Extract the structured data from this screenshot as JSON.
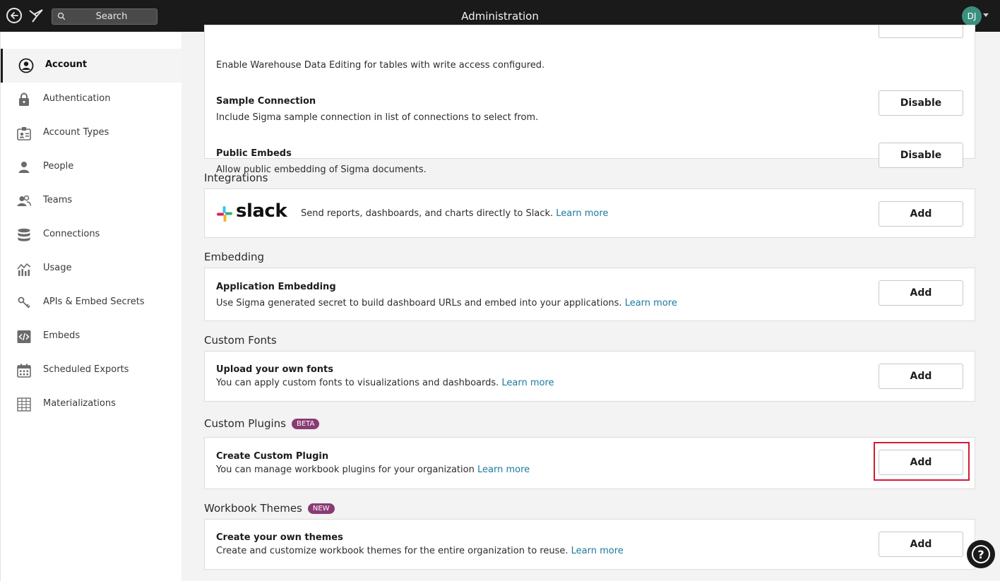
{
  "topbar": {
    "search_placeholder": "Search",
    "title": "Administration",
    "avatar_initials": "DJ"
  },
  "sidebar": {
    "items": [
      {
        "label": "Account",
        "icon": "account-circle-icon"
      },
      {
        "label": "Authentication",
        "icon": "lock-icon"
      },
      {
        "label": "Account Types",
        "icon": "id-badge-icon"
      },
      {
        "label": "People",
        "icon": "person-icon"
      },
      {
        "label": "Teams",
        "icon": "team-icon"
      },
      {
        "label": "Connections",
        "icon": "database-icon"
      },
      {
        "label": "Usage",
        "icon": "usage-icon"
      },
      {
        "label": "APIs & Embed Secrets",
        "icon": "key-icon"
      },
      {
        "label": "Embeds",
        "icon": "code-icon"
      },
      {
        "label": "Scheduled Exports",
        "icon": "calendar-icon"
      },
      {
        "label": "Materializations",
        "icon": "grid-icon"
      }
    ],
    "active": "Account"
  },
  "features": {
    "partial_desc": "Enable Warehouse Data Editing for tables with write access configured.",
    "sample_connection": {
      "title": "Sample Connection",
      "desc": "Include Sigma sample connection in list of connections to select from.",
      "button": "Disable"
    },
    "public_embeds": {
      "title": "Public Embeds",
      "desc": "Allow public embedding of Sigma documents.",
      "button": "Disable"
    }
  },
  "integrations": {
    "title": "Integrations",
    "slack_logo_text": "slack",
    "desc": "Send reports, dashboards, and charts directly to Slack.",
    "link": "Learn more",
    "button": "Add"
  },
  "embedding": {
    "title": "Embedding",
    "row_title": "Application Embedding",
    "desc": "Use Sigma generated secret to build dashboard URLs and embed into your applications.",
    "link": "Learn more",
    "button": "Add"
  },
  "custom_fonts": {
    "title": "Custom Fonts",
    "row_title": "Upload your own fonts",
    "desc": "You can apply custom fonts to visualizations and dashboards.",
    "link": "Learn more",
    "button": "Add"
  },
  "custom_plugins": {
    "title": "Custom Plugins",
    "badge": "BETA",
    "row_title": "Create Custom Plugin",
    "desc": "You can manage workbook plugins for your organization",
    "link": "Learn more",
    "button": "Add"
  },
  "workbook_themes": {
    "title": "Workbook Themes",
    "badge": "NEW",
    "row_title": "Create your own themes",
    "desc": "Create and customize workbook themes for the entire organization to reuse.",
    "link": "Learn more",
    "button": "Add"
  },
  "help_label": "?",
  "colors": {
    "accent_link": "#1a7aa0",
    "badge": "#8a3b75",
    "highlight": "#d21a35",
    "topbar": "#1a1a1a",
    "avatar": "#3b8f7f"
  }
}
